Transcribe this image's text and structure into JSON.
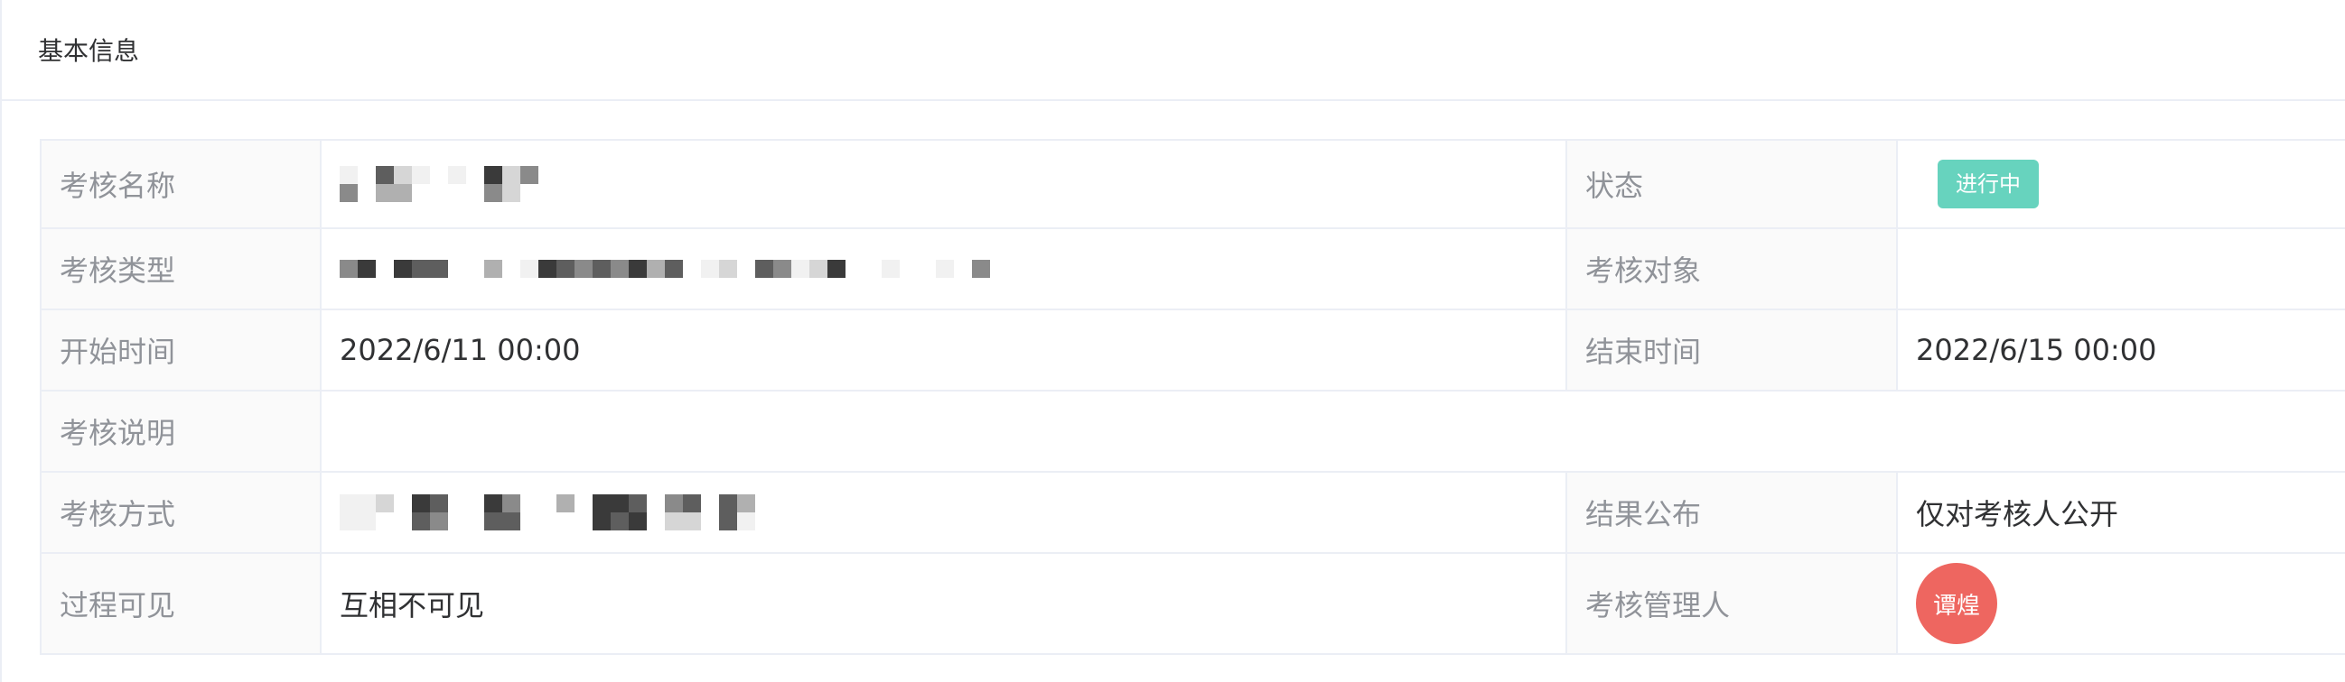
{
  "section": {
    "title": "基本信息"
  },
  "fields": {
    "exam_name": {
      "label": "考核名称",
      "value": ""
    },
    "status": {
      "label": "状态",
      "value": "进行中",
      "color": "#67d3be"
    },
    "exam_type": {
      "label": "考核类型",
      "value": ""
    },
    "exam_target": {
      "label": "考核对象",
      "value": ""
    },
    "start_time": {
      "label": "开始时间",
      "value": "2022/6/11 00:00"
    },
    "end_time": {
      "label": "结束时间",
      "value": "2022/6/15 00:00"
    },
    "exam_desc": {
      "label": "考核说明",
      "value": ""
    },
    "exam_method": {
      "label": "考核方式",
      "value": ""
    },
    "result_publish": {
      "label": "结果公布",
      "value": "仅对考核人公开"
    },
    "process_visible": {
      "label": "过程可见",
      "value": "互相不可见"
    },
    "exam_manager": {
      "label": "考核管理人",
      "avatar_text": "谭煌",
      "avatar_color": "#ee6660"
    }
  }
}
